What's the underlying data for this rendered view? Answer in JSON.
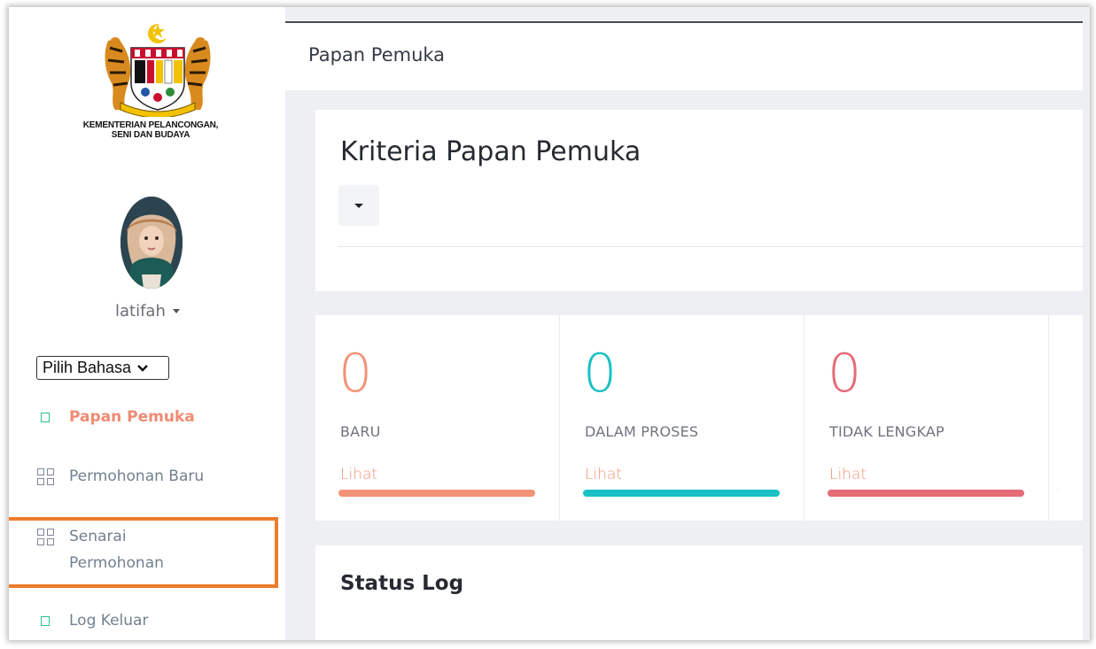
{
  "sidebar": {
    "ministry_line1": "KEMENTERIAN PELANCONGAN,",
    "ministry_line2": "SENI DAN BUDAYA",
    "username": "latifah",
    "language_select": "Pilih Bahasa",
    "nav": [
      {
        "label": "Papan Pemuka",
        "icon": "square-icon",
        "active": true
      },
      {
        "label": "Permohonan Baru",
        "icon": "grid-icon",
        "active": false
      },
      {
        "label_line1": "Senarai",
        "label_line2": "Permohonan",
        "icon": "grid-icon",
        "active": false
      },
      {
        "label": "Log Keluar",
        "icon": "square-icon",
        "active": false
      }
    ]
  },
  "header": {
    "title": "Papan Pemuka"
  },
  "criteria": {
    "title": "Kriteria Papan Pemuka"
  },
  "stats": [
    {
      "value": "0",
      "label": "BARU",
      "link": "Lihat",
      "color": "#f39276"
    },
    {
      "value": "0",
      "label": "DALAM PROSES",
      "link": "Lihat",
      "color": "#1ac0c6"
    },
    {
      "value": "0",
      "label": "TIDAK LENGKAP",
      "link": "Lihat",
      "color": "#e56b77"
    }
  ],
  "status_log": {
    "title": "Status Log"
  },
  "colors": {
    "accent_active": "#f08a72",
    "highlight_box": "#ee7c2c",
    "nav_square_icon": "#2ac08f"
  }
}
